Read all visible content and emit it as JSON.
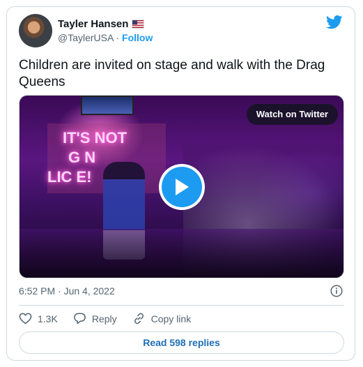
{
  "author": {
    "display_name": "Tayler Hansen",
    "flag_icon": "us-flag-icon",
    "handle": "@TaylerUSA",
    "separator": "·",
    "follow_label": "Follow"
  },
  "tweet": {
    "text": "Children are invited on stage and walk with the Drag Queens",
    "timestamp": "6:52 PM · Jun 4, 2022"
  },
  "media": {
    "watch_label": "Watch on Twitter",
    "neon_lines": [
      "IT'S NOT",
      "G  N",
      "LIC   E!"
    ]
  },
  "actions": {
    "likes_count": "1.3K",
    "reply_label": "Reply",
    "copy_link_label": "Copy link"
  },
  "replies_button": "Read 598 replies",
  "colors": {
    "accent": "#1d9bf0",
    "text": "#0f1419",
    "muted": "#536471",
    "border": "#cfd9de"
  }
}
